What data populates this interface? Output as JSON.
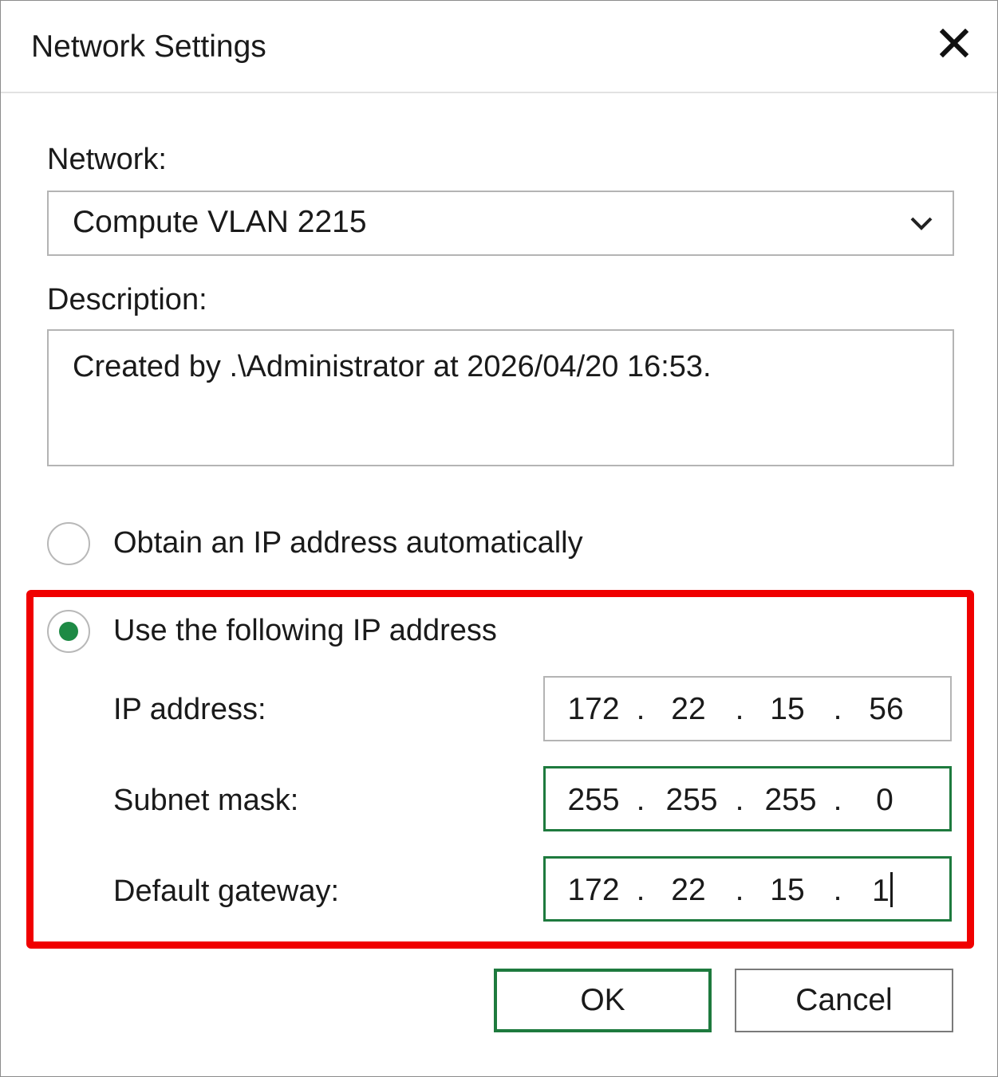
{
  "window": {
    "title": "Network Settings",
    "close_icon": "close-icon"
  },
  "network": {
    "label": "Network:",
    "selected": "Compute VLAN 2215"
  },
  "description": {
    "label": "Description:",
    "value": "Created by .\\Administrator at 2026/04/20 16:53."
  },
  "ip_mode": {
    "auto_label": "Obtain an IP address automatically",
    "auto_selected": false,
    "static_label": "Use the following IP address",
    "static_selected": true
  },
  "static": {
    "ip": {
      "label": "IP address:",
      "octets": [
        "172",
        "22",
        "15",
        "56"
      ]
    },
    "mask": {
      "label": "Subnet mask:",
      "octets": [
        "255",
        "255",
        "255",
        "0"
      ]
    },
    "gateway": {
      "label": "Default gateway:",
      "octets": [
        "172",
        "22",
        "15",
        "1"
      ]
    }
  },
  "buttons": {
    "ok": "OK",
    "cancel": "Cancel"
  },
  "colors": {
    "accent": "#1e8a45",
    "focus_border": "#1e7a3e",
    "highlight": "#f00000"
  }
}
